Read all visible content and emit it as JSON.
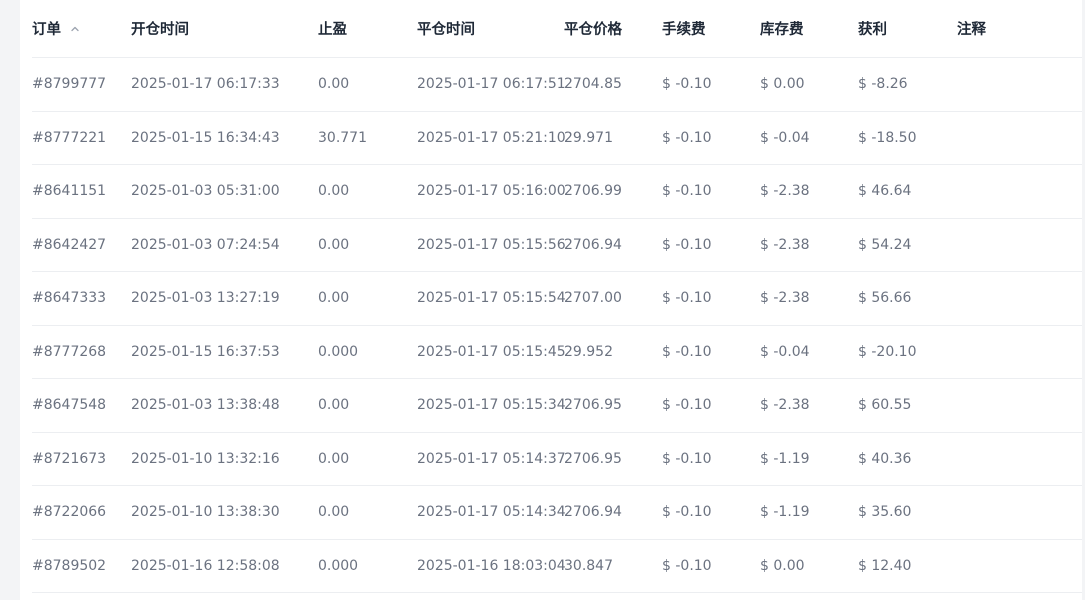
{
  "columns": {
    "order": "订单",
    "open_time": "开仓时间",
    "take_profit": "止盈",
    "close_time": "平仓时间",
    "close_price": "平仓价格",
    "commission": "手续费",
    "swap": "库存费",
    "profit": "获利",
    "note": "注释"
  },
  "sort": {
    "column": "order",
    "direction": "asc",
    "icon": "chevron-up-icon"
  },
  "colors": {
    "header_text": "#1f2937",
    "cell_text": "#6b7280",
    "divider": "#eceef1",
    "left_strip": "#f3f4f6"
  },
  "rows": [
    {
      "order": "#8799777",
      "open_time": "2025-01-17 06:17:33",
      "take_profit": "0.00",
      "close_time": "2025-01-17 06:17:51",
      "close_price": "2704.85",
      "commission": "$ -0.10",
      "swap": "$ 0.00",
      "profit": "$ -8.26",
      "note": ""
    },
    {
      "order": "#8777221",
      "open_time": "2025-01-15 16:34:43",
      "take_profit": "30.771",
      "close_time": "2025-01-17 05:21:10",
      "close_price": "29.971",
      "commission": "$ -0.10",
      "swap": "$ -0.04",
      "profit": "$ -18.50",
      "note": ""
    },
    {
      "order": "#8641151",
      "open_time": "2025-01-03 05:31:00",
      "take_profit": "0.00",
      "close_time": "2025-01-17 05:16:00",
      "close_price": "2706.99",
      "commission": "$ -0.10",
      "swap": "$ -2.38",
      "profit": "$ 46.64",
      "note": ""
    },
    {
      "order": "#8642427",
      "open_time": "2025-01-03 07:24:54",
      "take_profit": "0.00",
      "close_time": "2025-01-17 05:15:56",
      "close_price": "2706.94",
      "commission": "$ -0.10",
      "swap": "$ -2.38",
      "profit": "$ 54.24",
      "note": ""
    },
    {
      "order": "#8647333",
      "open_time": "2025-01-03 13:27:19",
      "take_profit": "0.00",
      "close_time": "2025-01-17 05:15:54",
      "close_price": "2707.00",
      "commission": "$ -0.10",
      "swap": "$ -2.38",
      "profit": "$ 56.66",
      "note": ""
    },
    {
      "order": "#8777268",
      "open_time": "2025-01-15 16:37:53",
      "take_profit": "0.000",
      "close_time": "2025-01-17 05:15:45",
      "close_price": "29.952",
      "commission": "$ -0.10",
      "swap": "$ -0.04",
      "profit": "$ -20.10",
      "note": ""
    },
    {
      "order": "#8647548",
      "open_time": "2025-01-03 13:38:48",
      "take_profit": "0.00",
      "close_time": "2025-01-17 05:15:34",
      "close_price": "2706.95",
      "commission": "$ -0.10",
      "swap": "$ -2.38",
      "profit": "$ 60.55",
      "note": ""
    },
    {
      "order": "#8721673",
      "open_time": "2025-01-10 13:32:16",
      "take_profit": "0.00",
      "close_time": "2025-01-17 05:14:37",
      "close_price": "2706.95",
      "commission": "$ -0.10",
      "swap": "$ -1.19",
      "profit": "$ 40.36",
      "note": ""
    },
    {
      "order": "#8722066",
      "open_time": "2025-01-10 13:38:30",
      "take_profit": "0.00",
      "close_time": "2025-01-17 05:14:34",
      "close_price": "2706.94",
      "commission": "$ -0.10",
      "swap": "$ -1.19",
      "profit": "$ 35.60",
      "note": ""
    },
    {
      "order": "#8789502",
      "open_time": "2025-01-16 12:58:08",
      "take_profit": "0.000",
      "close_time": "2025-01-16 18:03:04",
      "close_price": "30.847",
      "commission": "$ -0.10",
      "swap": "$ 0.00",
      "profit": "$ 12.40",
      "note": ""
    }
  ]
}
